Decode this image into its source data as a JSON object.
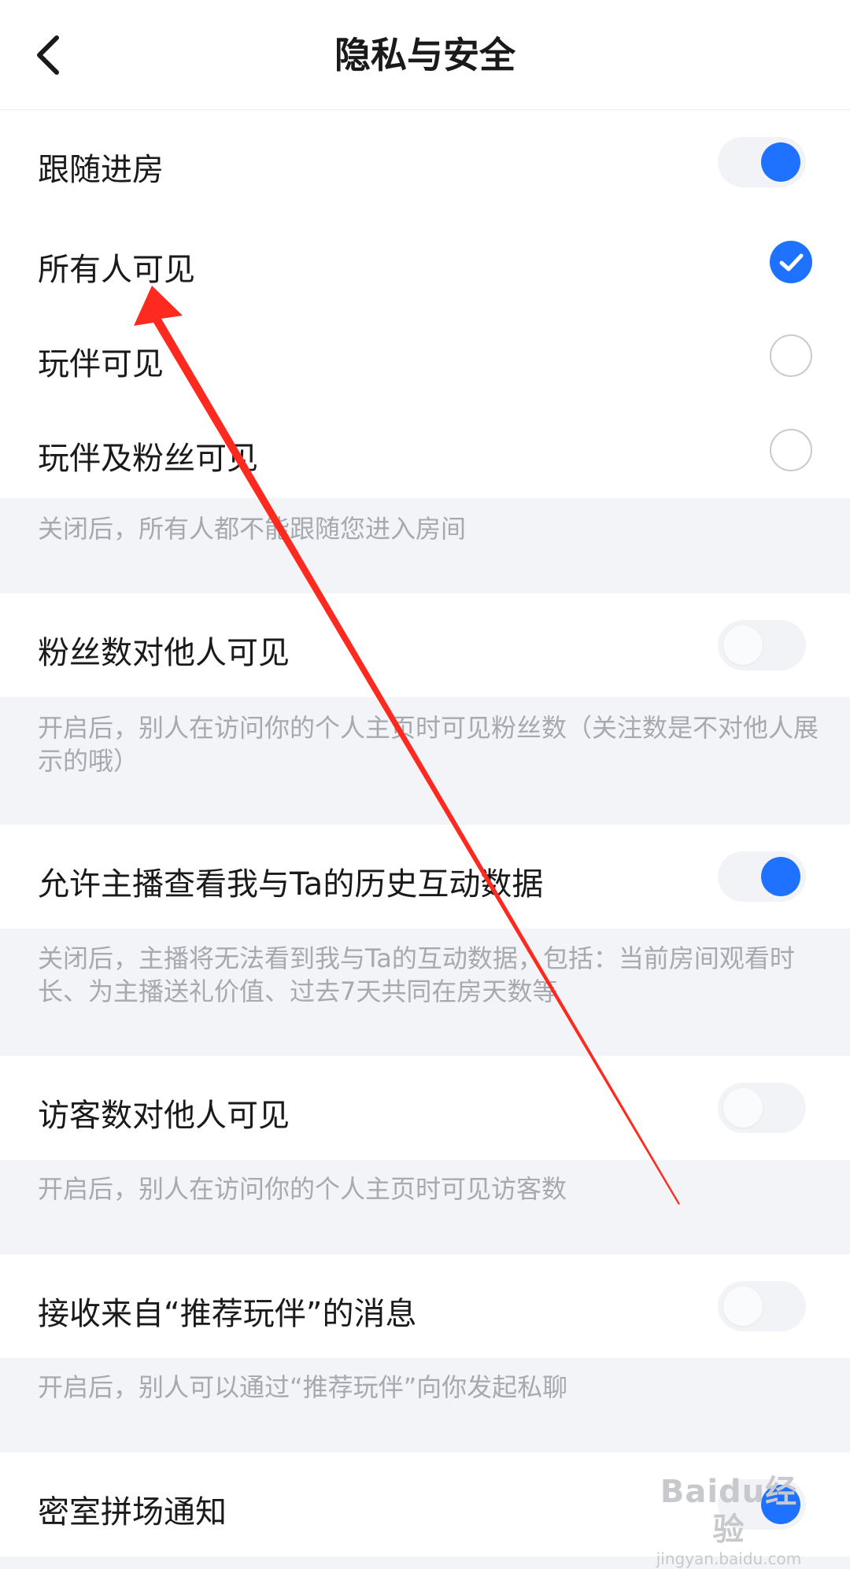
{
  "header": {
    "title": "隐私与安全",
    "back_icon": "chevron-left-icon"
  },
  "follow_room": {
    "label": "跟随进房",
    "toggle": "on",
    "options": [
      {
        "label": "所有人可见",
        "selected": true
      },
      {
        "label": "玩伴可见",
        "selected": false
      },
      {
        "label": "玩伴及粉丝可见",
        "selected": false
      }
    ],
    "hint": "关闭后，所有人都不能跟随您进入房间"
  },
  "fans_visible": {
    "label": "粉丝数对他人可见",
    "toggle": "off",
    "hint": "开启后，别人在访问你的个人主页时可见粉丝数（关注数是不对他人展示的哦）"
  },
  "host_data": {
    "label": "允许主播查看我与Ta的历史互动数据",
    "toggle": "on",
    "hint": "关闭后，主播将无法看到我与Ta的互动数据，包括：当前房间观看时长、为主播送礼价值、过去7天共同在房天数等"
  },
  "visitors_visible": {
    "label": "访客数对他人可见",
    "toggle": "off",
    "hint": "开启后，别人在访问你的个人主页时可见访客数"
  },
  "recommend_msg": {
    "label": "接收来自“推荐玩伴”的消息",
    "toggle": "off",
    "hint": "开启后，别人可以通过“推荐玩伴”向你发起私聊"
  },
  "escape_room": {
    "label": "密室拼场通知",
    "toggle": "on"
  },
  "watermark": {
    "logo": "Baidu经验",
    "url": "jingyan.baidu.com"
  },
  "colors": {
    "accent": "#1f72ff",
    "annotation_arrow": "#ff2a1f",
    "background": "#f3f4f8",
    "hint_text": "#a7a9b1"
  }
}
